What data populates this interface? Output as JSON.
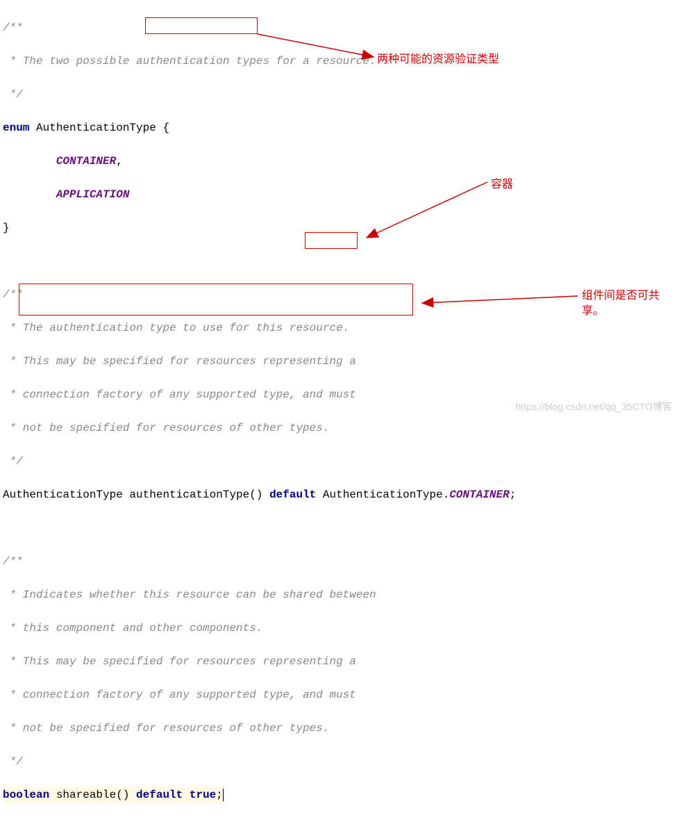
{
  "block1": {
    "c1": "/**",
    "c2_pre": " * The two possible ",
    "c2_box": "authentication",
    "c2_post": " types for a resource.",
    "c3": " */",
    "kw_enum": "enum",
    "type_name": " AuthenticationType {",
    "val1": "CONTAINER",
    "comma": ",",
    "val2": "APPLICATION",
    "close": "}"
  },
  "block2": {
    "c1": "/**",
    "c2": " * The authentication type to use for this resource.",
    "c3": " * This may be specified for resources representing a",
    "c4": " * connection factory of any supported type, and must",
    "c5": " * not be specified for resources of other types.",
    "c6": " */",
    "sig_type": "AuthenticationType authenticationType() ",
    "kw_default": "default",
    "sig_mid": " AuthenticationType.",
    "sig_val": "CONTAINER",
    "semi": ";"
  },
  "block3": {
    "c1": "/**",
    "c2": " * Indicates whether this resource can be shared between",
    "c3": " * this component and other components.",
    "c4": " * This may be specified for resources representing a",
    "c5": " * connection factory of any supported type, and must",
    "c6": " * not be specified for resources of other types.",
    "c7": " */",
    "kw_bool": "boolean",
    "sig_name": " shareable() ",
    "kw_default": "default",
    "kw_true": " true",
    "semi": ";"
  },
  "annotations": {
    "a1": "两种可能的资源验证类型",
    "a2": "容器",
    "a3_l1": "组件间是否可共",
    "a3_l2": "享。"
  },
  "watermark": "https://blog.csdn.net/qq_35CTO博客"
}
